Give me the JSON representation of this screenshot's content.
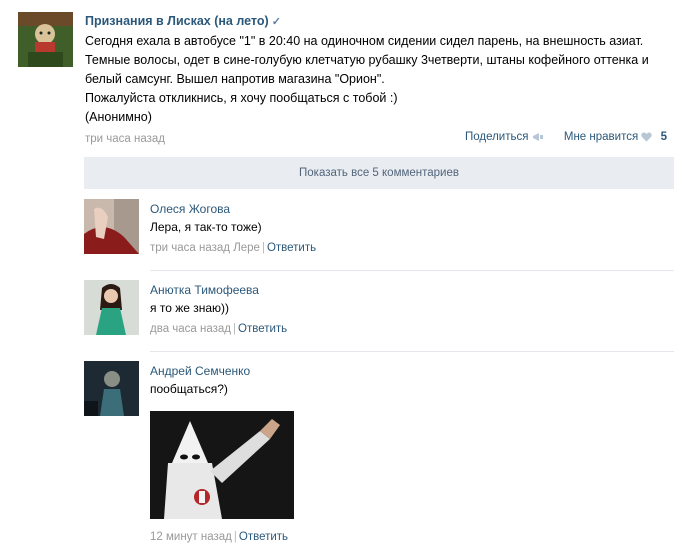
{
  "post": {
    "author": "Признания в Лисках (на лето)",
    "verified_mark": "✓",
    "lines": [
      "Сегодня ехала в автобусе \"1\" в 20:40 на одиночном сидении сидел парень, на внешность азиат.",
      "Темные волосы, одет в сине-голубую клетчатую рубашку 3четверти, штаны кофейного оттенка и",
      "белый самсунг. Вышел напротив магазина \"Орион\".",
      "Пожалуйста откликнись, я хочу пообщаться с тобой :)",
      "(Анонимно)"
    ],
    "time": "три часа назад",
    "share_label": "Поделиться",
    "like_label": "Мне нравится",
    "likes": "5"
  },
  "show_all": "Показать все 5 комментариев",
  "comments": [
    {
      "author": "Олеся Жогова",
      "text": "Лера, я так-то тоже)",
      "time": "три часа назад",
      "reply_to": "Лере",
      "reply": "Ответить"
    },
    {
      "author": "Анютка Тимофеева",
      "text": "я то же знаю))",
      "time": "два часа назад",
      "reply": "Ответить"
    },
    {
      "author": "Андрей Семченко",
      "text": "пообщаться?)",
      "time": "12 минут назад",
      "reply": "Ответить"
    }
  ],
  "colors": {
    "link": "#2b587a",
    "meta": "#999999",
    "show_all_bg": "#e9edf1",
    "divider": "#e4e8ec"
  }
}
